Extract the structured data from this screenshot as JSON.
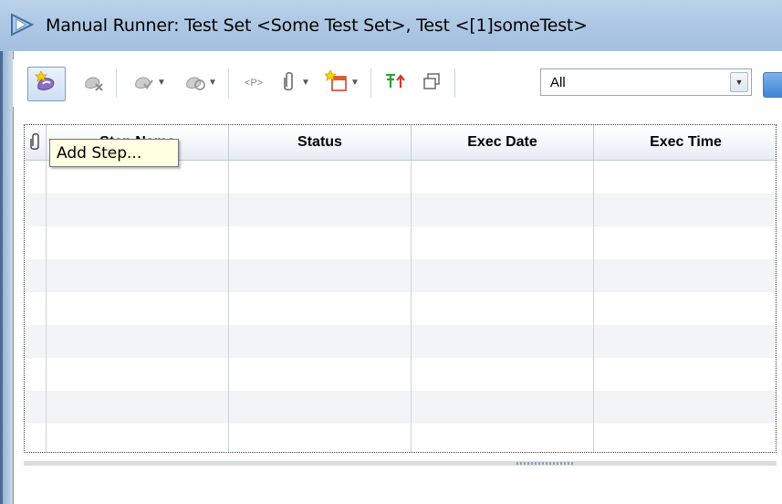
{
  "window": {
    "title": "Manual Runner: Test Set <Some Test Set>, Test <[1]someTest>"
  },
  "toolbar": {
    "buttons": [
      {
        "name": "add-step-button",
        "icon": "add-step-icon"
      },
      {
        "name": "delete-step-button",
        "icon": "delete-step-icon"
      },
      {
        "name": "pass-selected-button",
        "icon": "pass-selected-icon"
      },
      {
        "name": "fail-selected-button",
        "icon": "fail-selected-icon"
      },
      {
        "name": "parameters-button",
        "icon": "parameters-icon",
        "label": "<P>"
      },
      {
        "name": "attachments-button",
        "icon": "paperclip-icon"
      },
      {
        "name": "new-defect-button",
        "icon": "new-defect-icon"
      },
      {
        "name": "reset-button",
        "icon": "pin-icon"
      },
      {
        "name": "restore-button",
        "icon": "restore-window-icon"
      }
    ],
    "filter": {
      "value": "All"
    }
  },
  "grid": {
    "columns": [
      "Step Name",
      "Status",
      "Exec Date",
      "Exec Time"
    ]
  },
  "tooltip": {
    "text": "Add Step..."
  },
  "colors": {
    "title_bar": "#aec8e4",
    "tooltip_bg": "#ffffe1",
    "row_alt": "#f2f4f7",
    "accent_blue": "#3f83d3"
  }
}
